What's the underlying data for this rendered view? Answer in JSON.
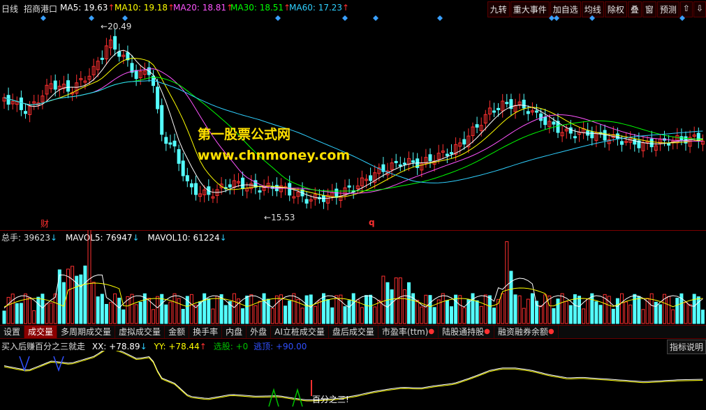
{
  "header": {
    "period": "日线",
    "stock_name": "招商港口",
    "ma": [
      {
        "label": "MA5: 19.63",
        "color": "#ffffff",
        "arrow": "↑",
        "arrow_color": "#ff3030"
      },
      {
        "label": "MA10: 19.18",
        "color": "#ffff00",
        "arrow": "↑",
        "arrow_color": "#ff3030"
      },
      {
        "label": "MA20: 18.81",
        "color": "#ff55ff",
        "arrow": "↑",
        "arrow_color": "#ff3030"
      },
      {
        "label": "MA30: 18.51",
        "color": "#00ff00",
        "arrow": "↑",
        "arrow_color": "#ff3030"
      },
      {
        "label": "MA60: 17.23",
        "color": "#2fd0ff",
        "arrow": "↑",
        "arrow_color": "#ff3030"
      }
    ],
    "buttons": [
      "九转",
      "重大事件",
      "加自选",
      "均线",
      "除权",
      "叠",
      "窗",
      "预测",
      "⇧",
      "⇩"
    ]
  },
  "price_chart": {
    "high_label": "20.49",
    "low_label": "15.53",
    "marker_cai": "财",
    "marker_q": "q",
    "watermark_cn": "第一股票公式网",
    "watermark_url": "www.chnmoney.com"
  },
  "volume_panel": {
    "total_label": "总手: 39623",
    "total_arrow": "↓",
    "mavol5_label": "MAVOL5: 76947",
    "mavol5_arrow": "↓",
    "mavol10_label": "MAVOL10: 61224",
    "mavol10_arrow": "↓"
  },
  "tabs": [
    {
      "label": "设置",
      "active": false,
      "dot": false
    },
    {
      "label": "成交量",
      "active": true,
      "dot": false
    },
    {
      "label": "多周期成交量",
      "active": false,
      "dot": false
    },
    {
      "label": "虚拟成交量",
      "active": false,
      "dot": false
    },
    {
      "label": "金额",
      "active": false,
      "dot": false
    },
    {
      "label": "换手率",
      "active": false,
      "dot": false
    },
    {
      "label": "内盘",
      "active": false,
      "dot": false
    },
    {
      "label": "外盘",
      "active": false,
      "dot": false
    },
    {
      "label": "AI立桩成交量",
      "active": false,
      "dot": false
    },
    {
      "label": "盘后成交量",
      "active": false,
      "dot": false
    },
    {
      "label": "市盈率(ttm)",
      "active": false,
      "dot": true
    },
    {
      "label": "陆股通持股",
      "active": false,
      "dot": true
    },
    {
      "label": "融资融券余额",
      "active": false,
      "dot": true
    }
  ],
  "indicator_panel": {
    "name": "买入后赚百分之三就走",
    "xx_label": "XX: +78.89",
    "xx_arrow": "↓",
    "yy_label": "YY: +78.44",
    "yy_arrow": "↑",
    "select_label": "选股: +0",
    "sell_label": "逃顶: +90.00",
    "help": "指标说明",
    "annotation": "百分之三!"
  },
  "colors": {
    "up": "#ff3030",
    "down": "#54ffff",
    "ma5": "#ffffff",
    "ma10": "#ffff00",
    "ma20": "#ff55ff",
    "ma30": "#00ff00",
    "ma60": "#2fd0ff"
  }
}
